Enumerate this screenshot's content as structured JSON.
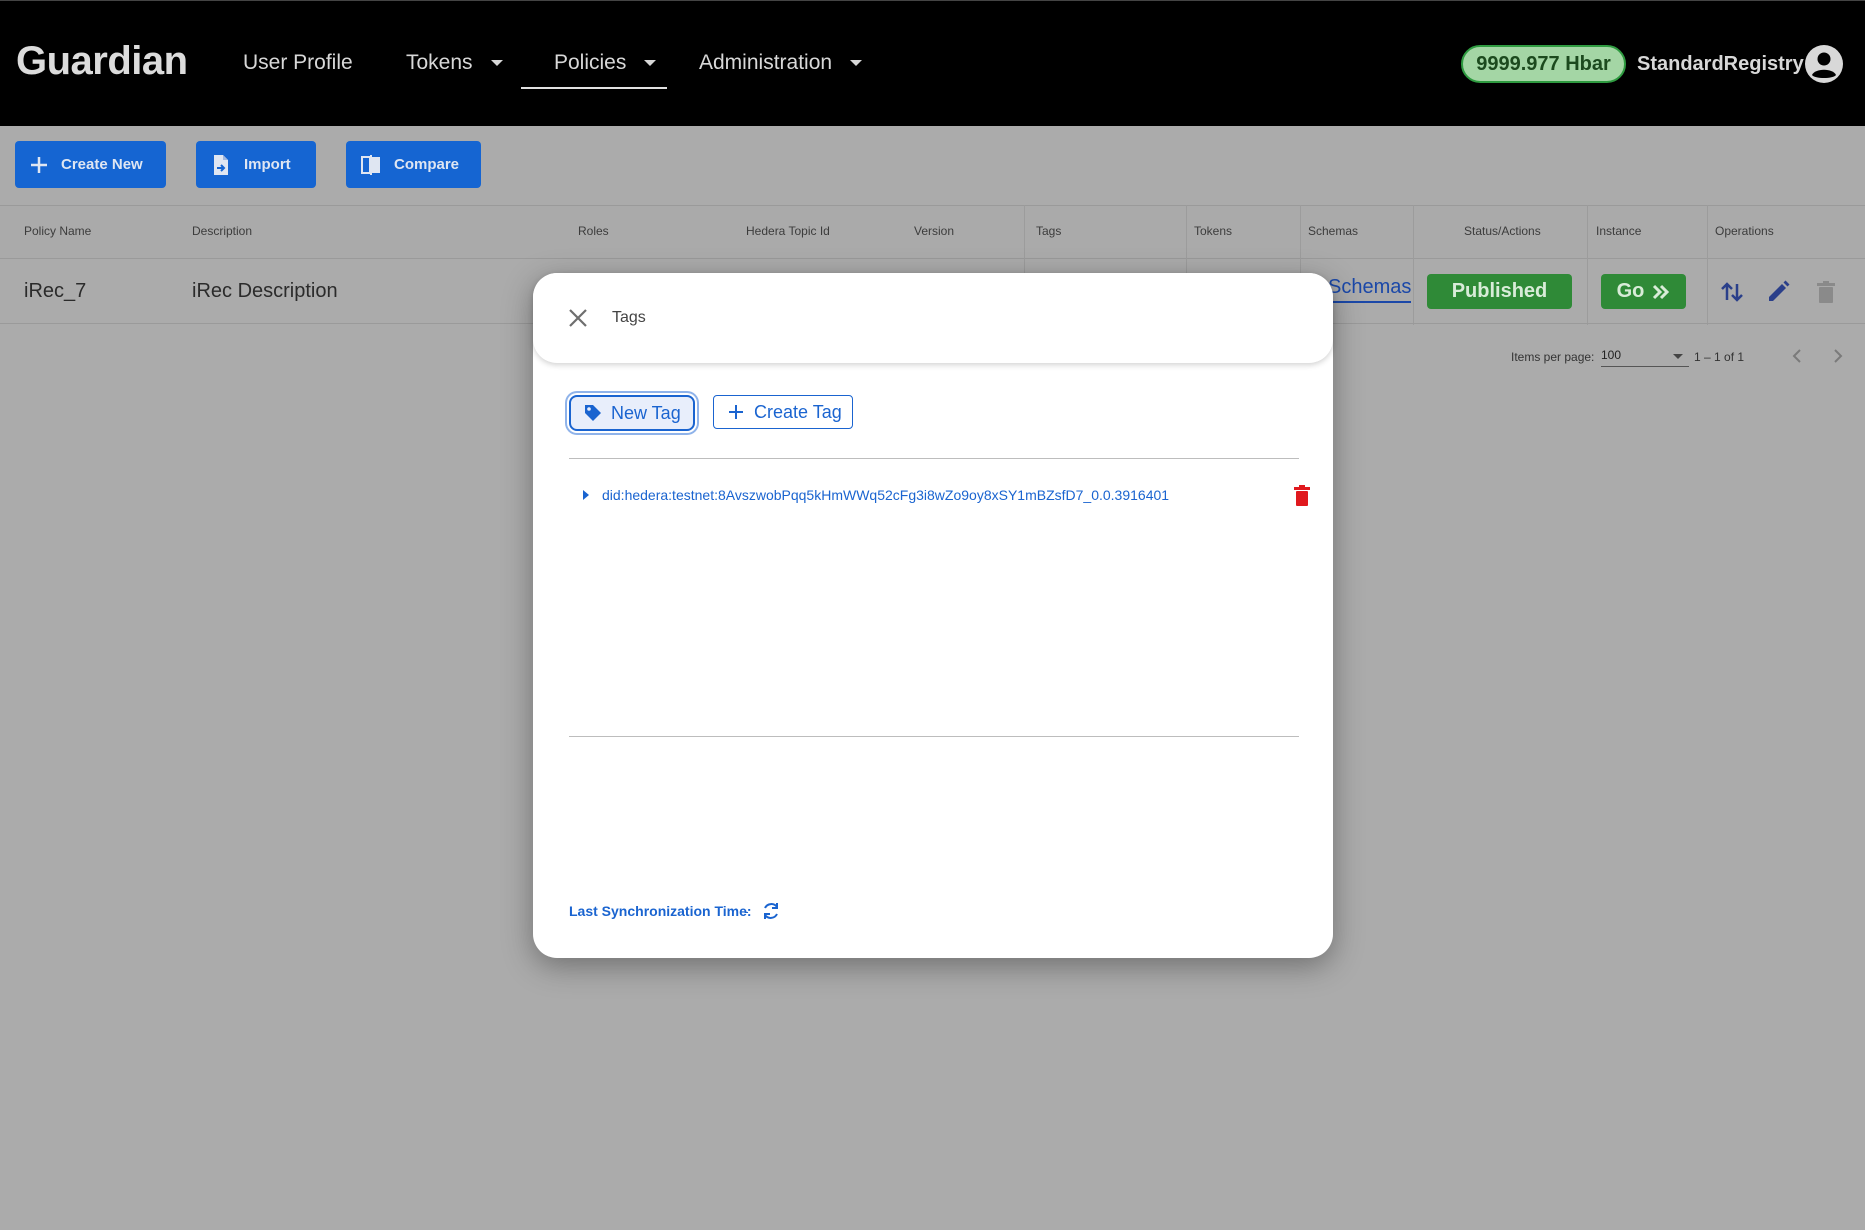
{
  "header": {
    "logo": "Guardian",
    "nav": [
      {
        "label": "User Profile",
        "has_dropdown": false
      },
      {
        "label": "Tokens",
        "has_dropdown": true
      },
      {
        "label": "Policies",
        "has_dropdown": true,
        "active": true
      },
      {
        "label": "Administration",
        "has_dropdown": true
      }
    ],
    "balance": "9999.977 Hbar",
    "username": "StandardRegistry"
  },
  "toolbar": {
    "create_new": "Create New",
    "import": "Import",
    "compare": "Compare"
  },
  "table": {
    "columns": [
      "Policy Name",
      "Description",
      "Roles",
      "Hedera Topic Id",
      "Version",
      "Tags",
      "Tokens",
      "Schemas",
      "Status/Actions",
      "Instance",
      "Operations"
    ],
    "rows": [
      {
        "policy_name": "iRec_7",
        "description": "iRec Description",
        "schemas_link": "Schemas",
        "status": "Published",
        "instance_button": "Go"
      }
    ]
  },
  "paginator": {
    "items_per_page_label": "Items per page:",
    "items_per_page_value": "100",
    "range_label": "1 – 1 of 1"
  },
  "dialog": {
    "title": "Tags",
    "new_tag_button": "New Tag",
    "create_tag_button": "Create Tag",
    "tags": [
      {
        "label": "did:hedera:testnet:8AvszwobPqq5kHmWWq52cFg3i8wZo9oy8xSY1mBZsfD7_0.0.3916401"
      }
    ],
    "sync_label": "Last Synchronization Time:",
    "sync_value": "-"
  },
  "colors": {
    "header_bg": "#000000",
    "primary_blue": "#1565d2",
    "status_green": "#2f8a37",
    "delete_red": "#e0191e",
    "overlay_bg": "#ababab"
  }
}
